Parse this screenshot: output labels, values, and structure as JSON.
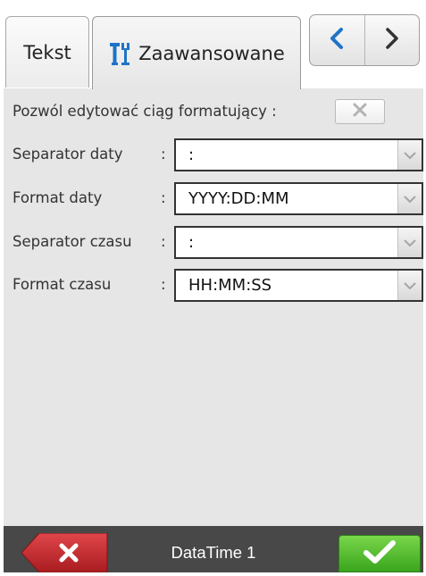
{
  "tabs": {
    "text_label": "Tekst",
    "advanced_label": "Zaawansowane"
  },
  "nav": {
    "prev_icon": "chevron-left-icon",
    "next_icon": "chevron-right-icon"
  },
  "form": {
    "allow_edit": {
      "label": "Pozwól edytować ciąg formatujący :",
      "checked": false
    },
    "rows": [
      {
        "label": "Separator daty",
        "colon": ":",
        "value": ":"
      },
      {
        "label": "Format daty",
        "colon": ":",
        "value": "YYYY:DD:MM"
      },
      {
        "label": "Separator czasu",
        "colon": ":",
        "value": ":"
      },
      {
        "label": "Format czasu",
        "colon": ":",
        "value": "HH:MM:SS"
      }
    ]
  },
  "bottom": {
    "title": "DataTime 1",
    "cancel_icon": "close-icon",
    "confirm_icon": "checkmark-icon"
  },
  "colors": {
    "accent_blue": "#1f73c7",
    "cancel_red": "#c8282c",
    "ok_green": "#4cbf2c",
    "panel_gray": "#e6e6e6",
    "bottom_bar": "#484848"
  }
}
